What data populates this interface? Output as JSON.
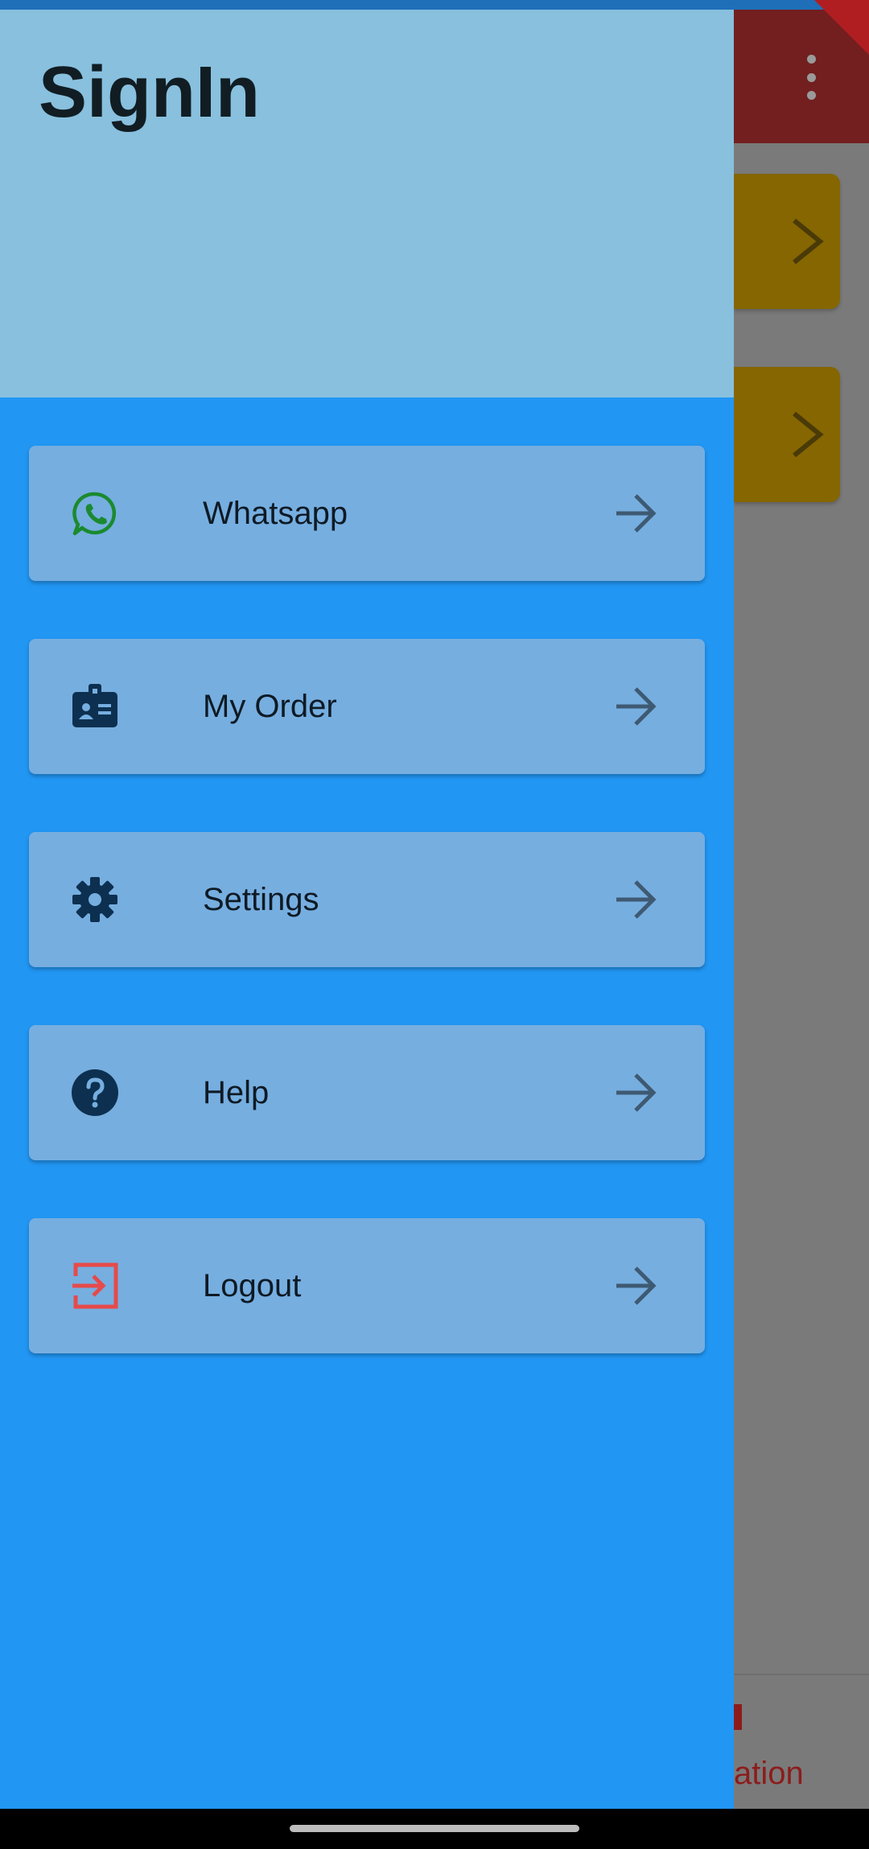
{
  "drawer": {
    "title": "SignIn",
    "items": [
      {
        "label": "Whatsapp",
        "icon": "whatsapp-icon",
        "icon_color": "#1b8a2f"
      },
      {
        "label": "My Order",
        "icon": "badge-icon",
        "icon_color": "#0d3050"
      },
      {
        "label": "Settings",
        "icon": "gear-icon",
        "icon_color": "#0d3050"
      },
      {
        "label": "Help",
        "icon": "help-icon",
        "icon_color": "#0d3050"
      },
      {
        "label": "Logout",
        "icon": "logout-icon",
        "icon_color": "#e64a4a"
      }
    ],
    "header_color": "#88c0de",
    "body_color": "#2196f3",
    "item_color": "#76aee0"
  },
  "background_app": {
    "appbar_color": "#731f1f",
    "card_color": "#856600",
    "bottom_nav_label_fragment": "ation"
  }
}
